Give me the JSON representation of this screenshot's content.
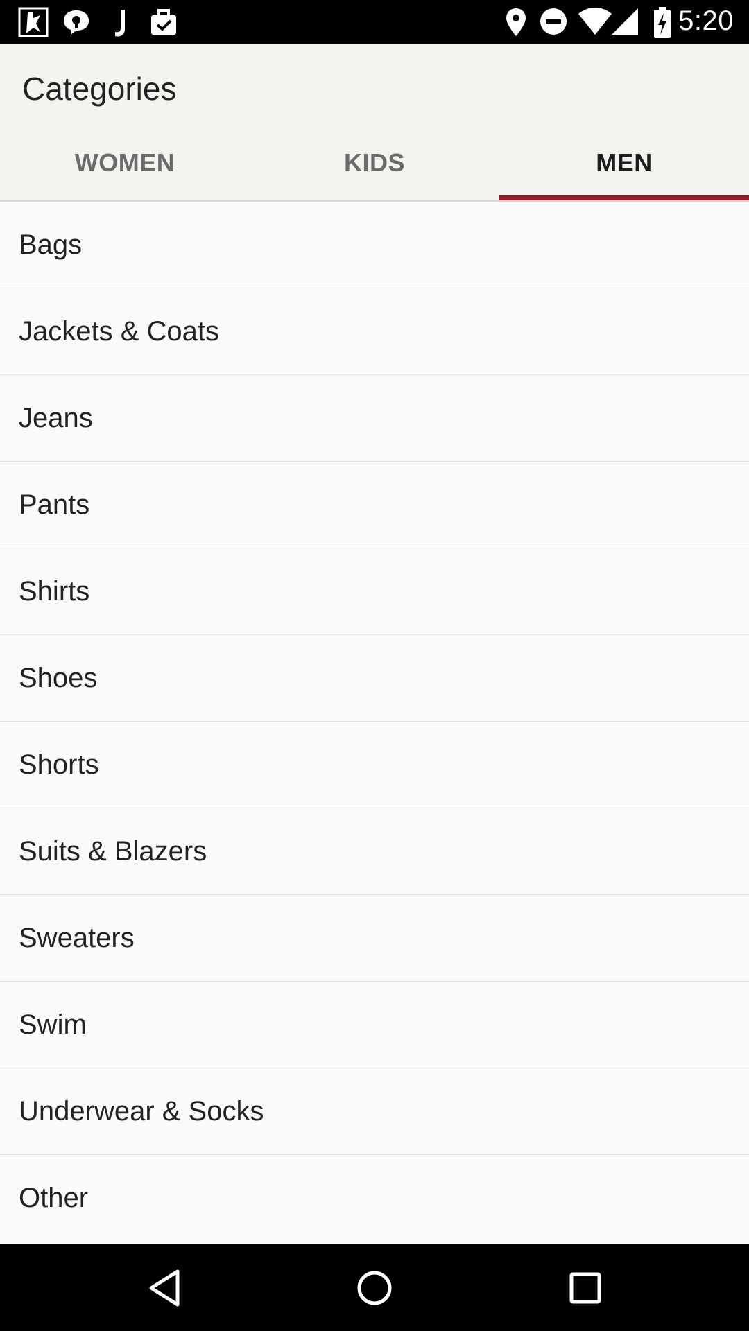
{
  "status_bar": {
    "time": "5:20",
    "left_icons": [
      "app-notification-icon",
      "chat-notification-icon",
      "j-notification-icon",
      "briefcase-notification-icon"
    ],
    "right_icons": [
      "location-icon",
      "do-not-disturb-icon",
      "wifi-icon",
      "cellular-signal-icon",
      "battery-charging-icon"
    ]
  },
  "app_bar": {
    "title": "Categories"
  },
  "tabs": [
    {
      "label": "WOMEN",
      "active": false
    },
    {
      "label": "KIDS",
      "active": false
    },
    {
      "label": "MEN",
      "active": true
    }
  ],
  "categories": [
    "Bags",
    "Jackets & Coats",
    "Jeans",
    "Pants",
    "Shirts",
    "Shoes",
    "Shorts",
    "Suits & Blazers",
    "Sweaters",
    "Swim",
    "Underwear & Socks",
    "Other"
  ],
  "nav_bar": {
    "buttons": [
      "back-icon",
      "home-icon",
      "recents-icon"
    ]
  },
  "colors": {
    "accent": "#8b1d2c",
    "app_bar_bg": "#f5f3ef",
    "list_bg": "#fafafa"
  }
}
